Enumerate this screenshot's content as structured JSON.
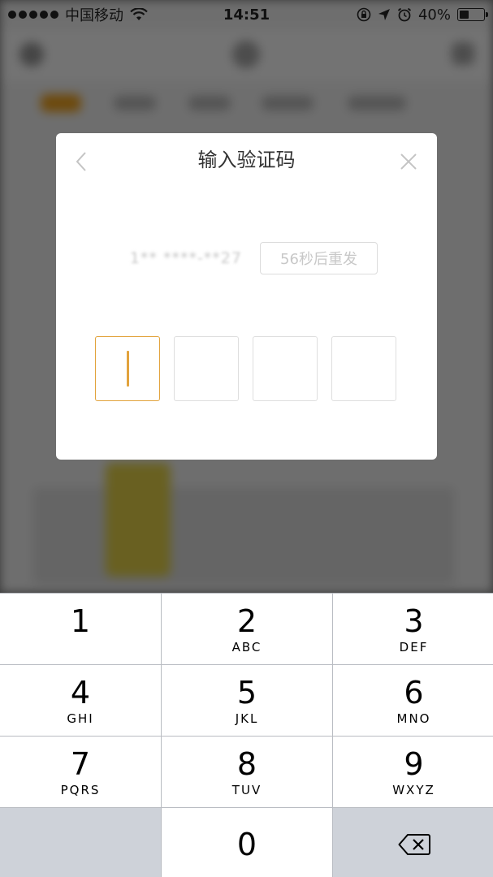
{
  "status_bar": {
    "carrier": "中国移动",
    "time": "14:51",
    "battery": "40%",
    "battery_level": 0.4
  },
  "modal": {
    "title": "输入验证码",
    "phone_number": "1** ****-**27",
    "resend_label": "56秒后重发",
    "code_boxes": [
      "",
      "",
      "",
      ""
    ],
    "active_box": 0,
    "accent_color": "#e2a33d"
  },
  "keypad": {
    "keys": [
      {
        "digit": "1",
        "letters": ""
      },
      {
        "digit": "2",
        "letters": "ABC"
      },
      {
        "digit": "3",
        "letters": "DEF"
      },
      {
        "digit": "4",
        "letters": "GHI"
      },
      {
        "digit": "5",
        "letters": "JKL"
      },
      {
        "digit": "6",
        "letters": "MNO"
      },
      {
        "digit": "7",
        "letters": "PQRS"
      },
      {
        "digit": "8",
        "letters": "TUV"
      },
      {
        "digit": "9",
        "letters": "WXYZ"
      },
      {
        "digit": "0",
        "letters": ""
      }
    ],
    "delete_icon": "backspace-icon"
  }
}
